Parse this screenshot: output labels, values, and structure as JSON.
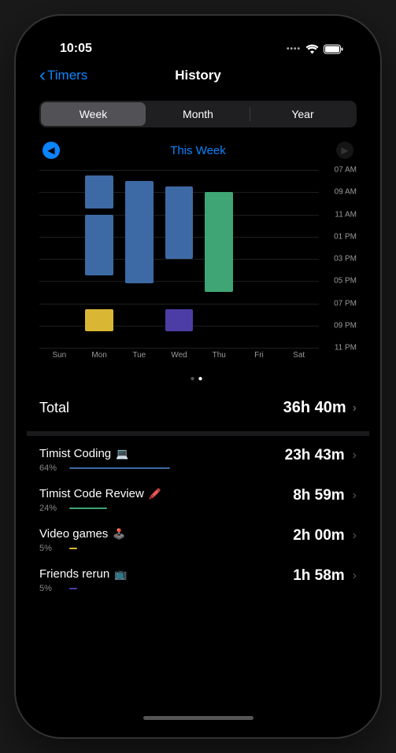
{
  "status": {
    "time": "10:05"
  },
  "nav": {
    "back_label": "Timers",
    "title": "History"
  },
  "segments": {
    "week": "Week",
    "month": "Month",
    "year": "Year"
  },
  "period": {
    "label": "This Week"
  },
  "chart_data": {
    "type": "bar",
    "y_ticks": [
      "07 AM",
      "09 AM",
      "11 AM",
      "01 PM",
      "03 PM",
      "05 PM",
      "07 PM",
      "09 PM",
      "11 PM"
    ],
    "x_categories": [
      "Sun",
      "Mon",
      "Tue",
      "Wed",
      "Thu",
      "Fri",
      "Sat"
    ],
    "y_range_hours": [
      7,
      23
    ],
    "series_colors": {
      "coding": "#3d6aa5",
      "review": "#3fa574",
      "games": "#d9b735",
      "friends": "#4c3da5"
    },
    "bars": [
      {
        "day": "Mon",
        "category": "coding",
        "start": 7.5,
        "end": 10.5
      },
      {
        "day": "Mon",
        "category": "coding",
        "start": 11.0,
        "end": 16.5
      },
      {
        "day": "Mon",
        "category": "games",
        "start": 19.5,
        "end": 21.5
      },
      {
        "day": "Tue",
        "category": "coding",
        "start": 8.0,
        "end": 17.2
      },
      {
        "day": "Wed",
        "category": "coding",
        "start": 8.5,
        "end": 15.0
      },
      {
        "day": "Wed",
        "category": "friends",
        "start": 19.5,
        "end": 21.5
      },
      {
        "day": "Thu",
        "category": "review",
        "start": 9.0,
        "end": 18.0
      }
    ]
  },
  "total": {
    "label": "Total",
    "value": "36h 40m"
  },
  "categories": [
    {
      "name": "Timist Coding",
      "emoji": "💻",
      "percent": "64%",
      "bar_pct": 64,
      "color": "#3d6aa5",
      "value": "23h 43m"
    },
    {
      "name": "Timist Code Review",
      "emoji": "🖍️",
      "percent": "24%",
      "bar_pct": 24,
      "color": "#3fa574",
      "value": "8h 59m"
    },
    {
      "name": "Video games",
      "emoji": "🕹️",
      "percent": "5%",
      "bar_pct": 5,
      "color": "#d9b735",
      "value": "2h 00m"
    },
    {
      "name": "Friends rerun",
      "emoji": "📺",
      "percent": "5%",
      "bar_pct": 5,
      "color": "#4c3da5",
      "value": "1h 58m"
    }
  ]
}
